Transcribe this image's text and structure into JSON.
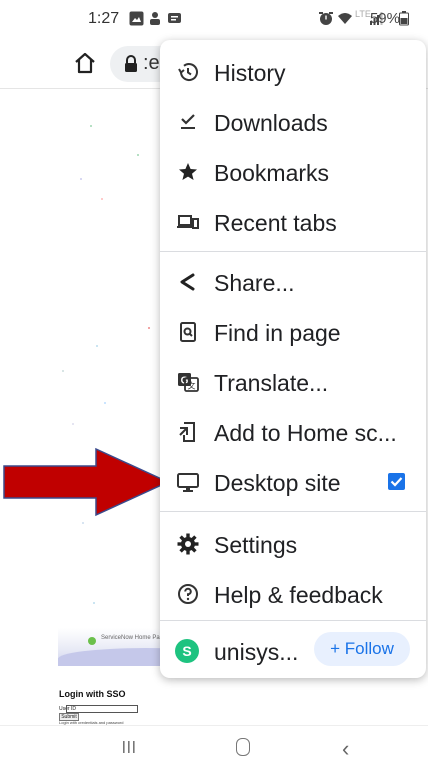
{
  "status_bar": {
    "time": "1:27",
    "right_text": "         59%",
    "battery": "59%"
  },
  "url_bar": {
    "url_fragment": ":e"
  },
  "menu": {
    "items": [
      {
        "label": "History",
        "icon": "history-icon"
      },
      {
        "label": "Downloads",
        "icon": "downloads-icon"
      },
      {
        "label": "Bookmarks",
        "icon": "star-icon"
      },
      {
        "label": "Recent tabs",
        "icon": "devices-icon"
      },
      {
        "label": "Share...",
        "icon": "share-icon"
      },
      {
        "label": "Find in page",
        "icon": "find-in-page-icon"
      },
      {
        "label": "Translate...",
        "icon": "translate-icon"
      },
      {
        "label": "Add to Home sc...",
        "icon": "add-to-home-icon"
      },
      {
        "label": "Desktop site",
        "icon": "monitor-icon",
        "checked": true
      },
      {
        "label": "Settings",
        "icon": "gear-icon"
      },
      {
        "label": "Help & feedback",
        "icon": "help-icon"
      }
    ],
    "site": {
      "avatar_letter": "S",
      "name": "unisys...",
      "follow_label": "+ Follow"
    }
  },
  "page": {
    "banner_text": "ServiceNow Home Page",
    "login_title": "Login with SSO",
    "user_id_label": "User ID",
    "submit_label": "Submit",
    "help_text": "Login with credentials and password"
  },
  "colors": {
    "accent": "#1a73e8",
    "arrow": "#c00000",
    "avatar": "#1ec380"
  }
}
